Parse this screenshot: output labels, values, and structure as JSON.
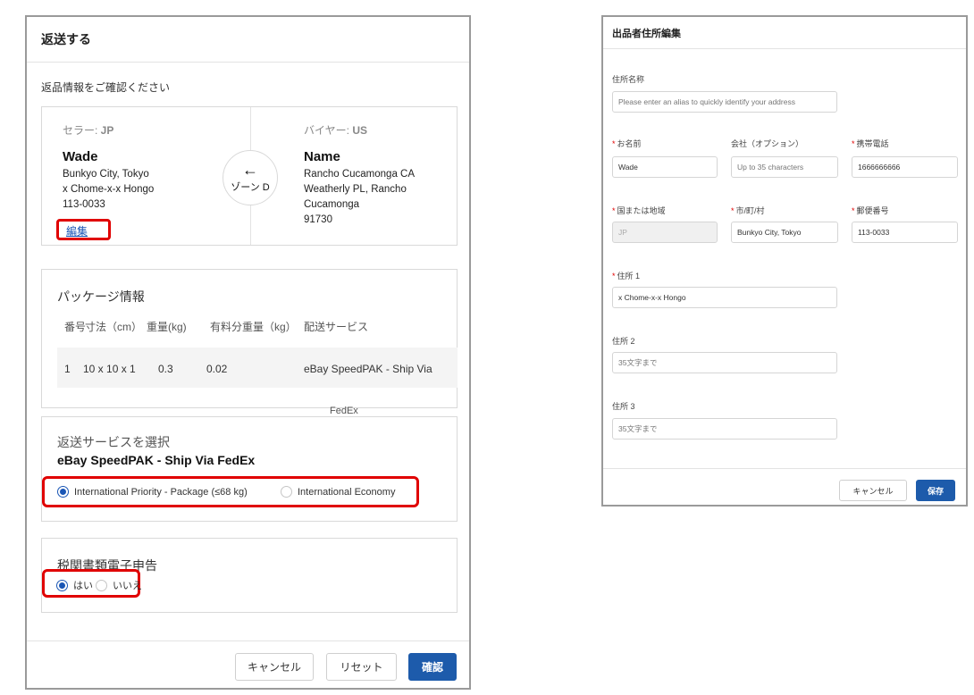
{
  "return_dialog": {
    "title": "返送する",
    "subtitle": "返品情報をご確認ください",
    "seller": {
      "label_prefix": "セラー: ",
      "label_code": "JP",
      "name": "Wade",
      "lines": [
        "Bunkyo City, Tokyo",
        "x Chome-x-x Hongo",
        "113-0033"
      ],
      "edit_label": "編集"
    },
    "zone": {
      "arrow": "←",
      "label": "ゾーン D"
    },
    "buyer": {
      "label_prefix": "バイヤー: ",
      "label_code": "US",
      "name": "Name",
      "lines": [
        "Rancho Cucamonga CA",
        "Weatherly PL, Rancho",
        "Cucamonga",
        "91730"
      ]
    },
    "package": {
      "title": "パッケージ情報",
      "columns": [
        "番号",
        "寸法（cm）",
        "重量(kg)",
        "有料分重量（kg）",
        "配送サービス"
      ],
      "rows": [
        {
          "no": "1",
          "size": "10 x 10 x 1",
          "weight": "0.3",
          "charged": "0.02",
          "service": "eBay SpeedPAK - Ship Via"
        }
      ],
      "service_overflow": "FedEx"
    },
    "service": {
      "label": "返送サービスを選択",
      "name": "eBay SpeedPAK - Ship Via FedEx",
      "options": [
        "International Priority - Package (≤68 kg)",
        "International Economy"
      ],
      "selected": 0
    },
    "customs": {
      "label": "税関書類電子申告",
      "options": [
        "はい",
        "いいえ"
      ],
      "selected": 0
    },
    "buttons": {
      "cancel": "キャンセル",
      "reset": "リセット",
      "confirm": "確認"
    }
  },
  "address_dialog": {
    "title": "出品者住所編集",
    "alias": {
      "label": "住所名称",
      "placeholder": "Please enter an alias to quickly identify your address"
    },
    "name": {
      "label": "お名前",
      "value": "Wade"
    },
    "company": {
      "label": "会社（オプション）",
      "placeholder": "Up to 35 characters"
    },
    "phone": {
      "label": "携帯電話",
      "value": "1666666666"
    },
    "country": {
      "label": "国または地域",
      "value": "JP"
    },
    "city": {
      "label": "市/町/村",
      "value": "Bunkyo City, Tokyo"
    },
    "postal": {
      "label": "郵便番号",
      "value": "113-0033"
    },
    "address1": {
      "label": "住所 1",
      "value": "x Chome-x-x Hongo"
    },
    "address2": {
      "label": "住所 2",
      "placeholder": "35文字まで"
    },
    "address3": {
      "label": "住所 3",
      "placeholder": "35文字まで"
    },
    "buttons": {
      "cancel": "キャンセル",
      "save": "保存"
    }
  },
  "colors": {
    "primary": "#1d5bab",
    "highlight_red": "#e00000",
    "required_red": "#e00000"
  }
}
